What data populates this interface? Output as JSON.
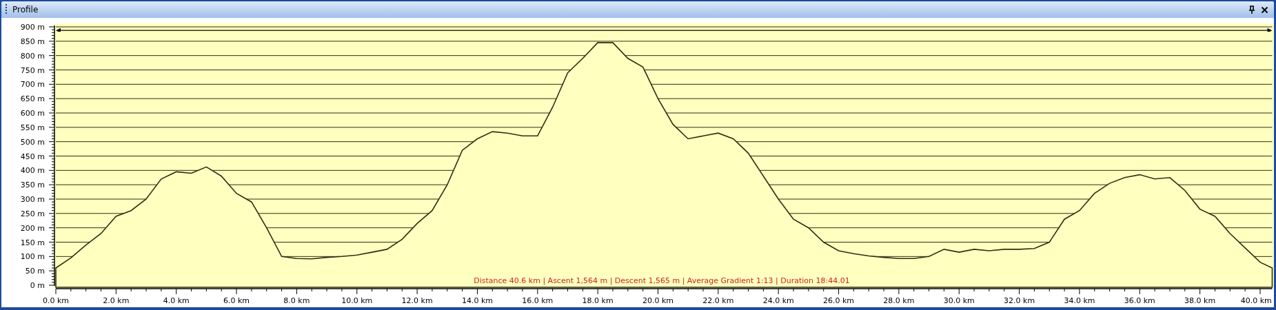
{
  "window": {
    "title": "Profile"
  },
  "profile": {
    "summary": "Distance 40.6 km | Ascent 1,564 m | Descent 1,565 m | Average Gradient 1:13 | Duration 18:44.01",
    "chart_data": {
      "type": "area",
      "x": [
        0,
        0.5,
        1,
        1.5,
        2,
        2.5,
        3,
        3.5,
        4,
        4.5,
        5,
        5.5,
        6,
        6.5,
        7,
        7.5,
        8,
        8.5,
        9,
        9.5,
        10,
        10.5,
        11,
        11.5,
        12,
        12.5,
        13,
        13.5,
        14,
        14.5,
        15,
        15.5,
        16,
        16.5,
        17,
        17.5,
        18,
        18.5,
        19,
        19.5,
        20,
        20.5,
        21,
        21.5,
        22,
        22.5,
        23,
        23.5,
        24,
        24.5,
        25,
        25.5,
        26,
        26.5,
        27,
        27.5,
        28,
        28.5,
        29,
        29.5,
        30,
        30.5,
        31,
        31.5,
        32,
        32.5,
        33,
        33.5,
        34,
        34.5,
        35,
        35.5,
        36,
        36.5,
        37,
        37.5,
        38,
        38.5,
        39,
        39.5,
        40,
        40.4
      ],
      "values": [
        60,
        95,
        140,
        180,
        240,
        260,
        300,
        370,
        395,
        390,
        412,
        380,
        320,
        290,
        200,
        100,
        93,
        92,
        97,
        100,
        105,
        115,
        125,
        160,
        215,
        260,
        350,
        470,
        510,
        535,
        530,
        520,
        520,
        620,
        740,
        790,
        845,
        845,
        790,
        760,
        650,
        560,
        510,
        520,
        530,
        510,
        460,
        380,
        300,
        230,
        200,
        150,
        120,
        110,
        102,
        97,
        93,
        93,
        100,
        125,
        115,
        125,
        120,
        125,
        125,
        128,
        150,
        230,
        260,
        320,
        355,
        375,
        385,
        370,
        375,
        330,
        265,
        240,
        180,
        130,
        80,
        60
      ],
      "xlim": [
        0,
        40.4
      ],
      "ylim": [
        0,
        900
      ],
      "grid": true,
      "yticks": [
        {
          "value": 0,
          "label": "0 m"
        },
        {
          "value": 50,
          "label": "50 m"
        },
        {
          "value": 100,
          "label": "100 m"
        },
        {
          "value": 150,
          "label": "150 m"
        },
        {
          "value": 200,
          "label": "200 m"
        },
        {
          "value": 250,
          "label": "250 m"
        },
        {
          "value": 300,
          "label": "300 m"
        },
        {
          "value": 350,
          "label": "350 m"
        },
        {
          "value": 400,
          "label": "400 m"
        },
        {
          "value": 450,
          "label": "450 m"
        },
        {
          "value": 500,
          "label": "500 m"
        },
        {
          "value": 550,
          "label": "550 m"
        },
        {
          "value": 600,
          "label": "600 m"
        },
        {
          "value": 650,
          "label": "650 m"
        },
        {
          "value": 700,
          "label": "700 m"
        },
        {
          "value": 750,
          "label": "750 m"
        },
        {
          "value": 800,
          "label": "800 m"
        },
        {
          "value": 850,
          "label": "850 m"
        },
        {
          "value": 900,
          "label": "900 m"
        }
      ],
      "xticks": [
        {
          "value": 0,
          "label": "0.0 km"
        },
        {
          "value": 2,
          "label": "2.0 km"
        },
        {
          "value": 4,
          "label": "4.0 km"
        },
        {
          "value": 6,
          "label": "6.0 km"
        },
        {
          "value": 8,
          "label": "8.0 km"
        },
        {
          "value": 10,
          "label": "10.0 km"
        },
        {
          "value": 12,
          "label": "12.0 km"
        },
        {
          "value": 14,
          "label": "14.0 km"
        },
        {
          "value": 16,
          "label": "16.0 km"
        },
        {
          "value": 18,
          "label": "18.0 km"
        },
        {
          "value": 20,
          "label": "20.0 km"
        },
        {
          "value": 22,
          "label": "22.0 km"
        },
        {
          "value": 24,
          "label": "24.0 km"
        },
        {
          "value": 26,
          "label": "26.0 km"
        },
        {
          "value": 28,
          "label": "28.0 km"
        },
        {
          "value": 30,
          "label": "30.0 km"
        },
        {
          "value": 32,
          "label": "32.0 km"
        },
        {
          "value": 34,
          "label": "34.0 km"
        },
        {
          "value": 36,
          "label": "36.0 km"
        },
        {
          "value": 38,
          "label": "38.0 km"
        },
        {
          "value": 40,
          "label": "40.0 km"
        }
      ]
    }
  }
}
